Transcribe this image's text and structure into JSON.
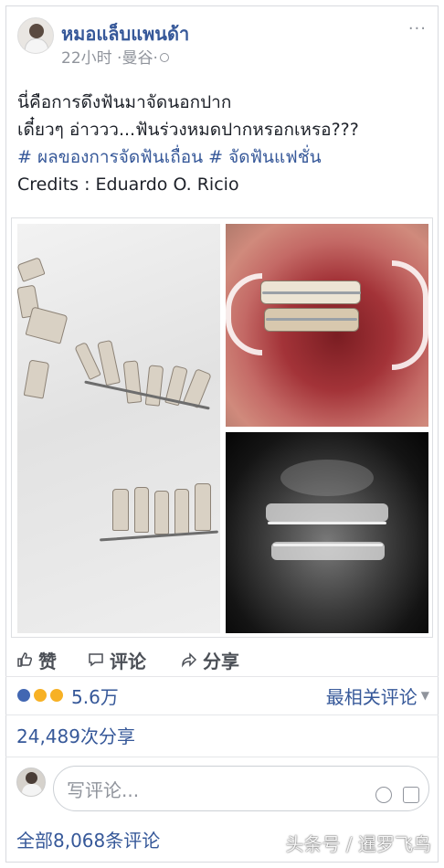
{
  "post": {
    "page_name": "หมอแล็บแพนด้า",
    "time": "22小时 ·曼谷·",
    "more": "···",
    "text_lines": [
      "นี่คือการดึงฟันมาจัดนอกปาก",
      "เดี๋ยวๆ อ่าววว...ฟันร่วงหมดปากหรอกเหรอ???"
    ],
    "hashtags": "# ผลของการจัดฟันเถื่อน # จัดฟันแฟชั่น",
    "credits": "Credits : Eduardo O. Ricio"
  },
  "actions": {
    "like_label": "赞",
    "comment_label": "评论",
    "share_label": "分享"
  },
  "reactions": {
    "count": "5.6万",
    "sort_label": "最相关评论",
    "colors": [
      "#4267b2",
      "#f7b125",
      "#f7b125"
    ]
  },
  "shares": {
    "text": "24,489次分享"
  },
  "comment_box": {
    "placeholder": "写评论..."
  },
  "comments": {
    "all_label": "全部8,068条评论"
  },
  "watermark": {
    "text": "头条号 / 暹罗飞鸟"
  },
  "icons": {
    "like": "thumbs-up-icon",
    "comment": "comment-bubble-icon",
    "share": "share-arrow-icon",
    "privacy": "globe-icon",
    "emoji": "smiley-icon",
    "sticker": "sticker-icon"
  }
}
